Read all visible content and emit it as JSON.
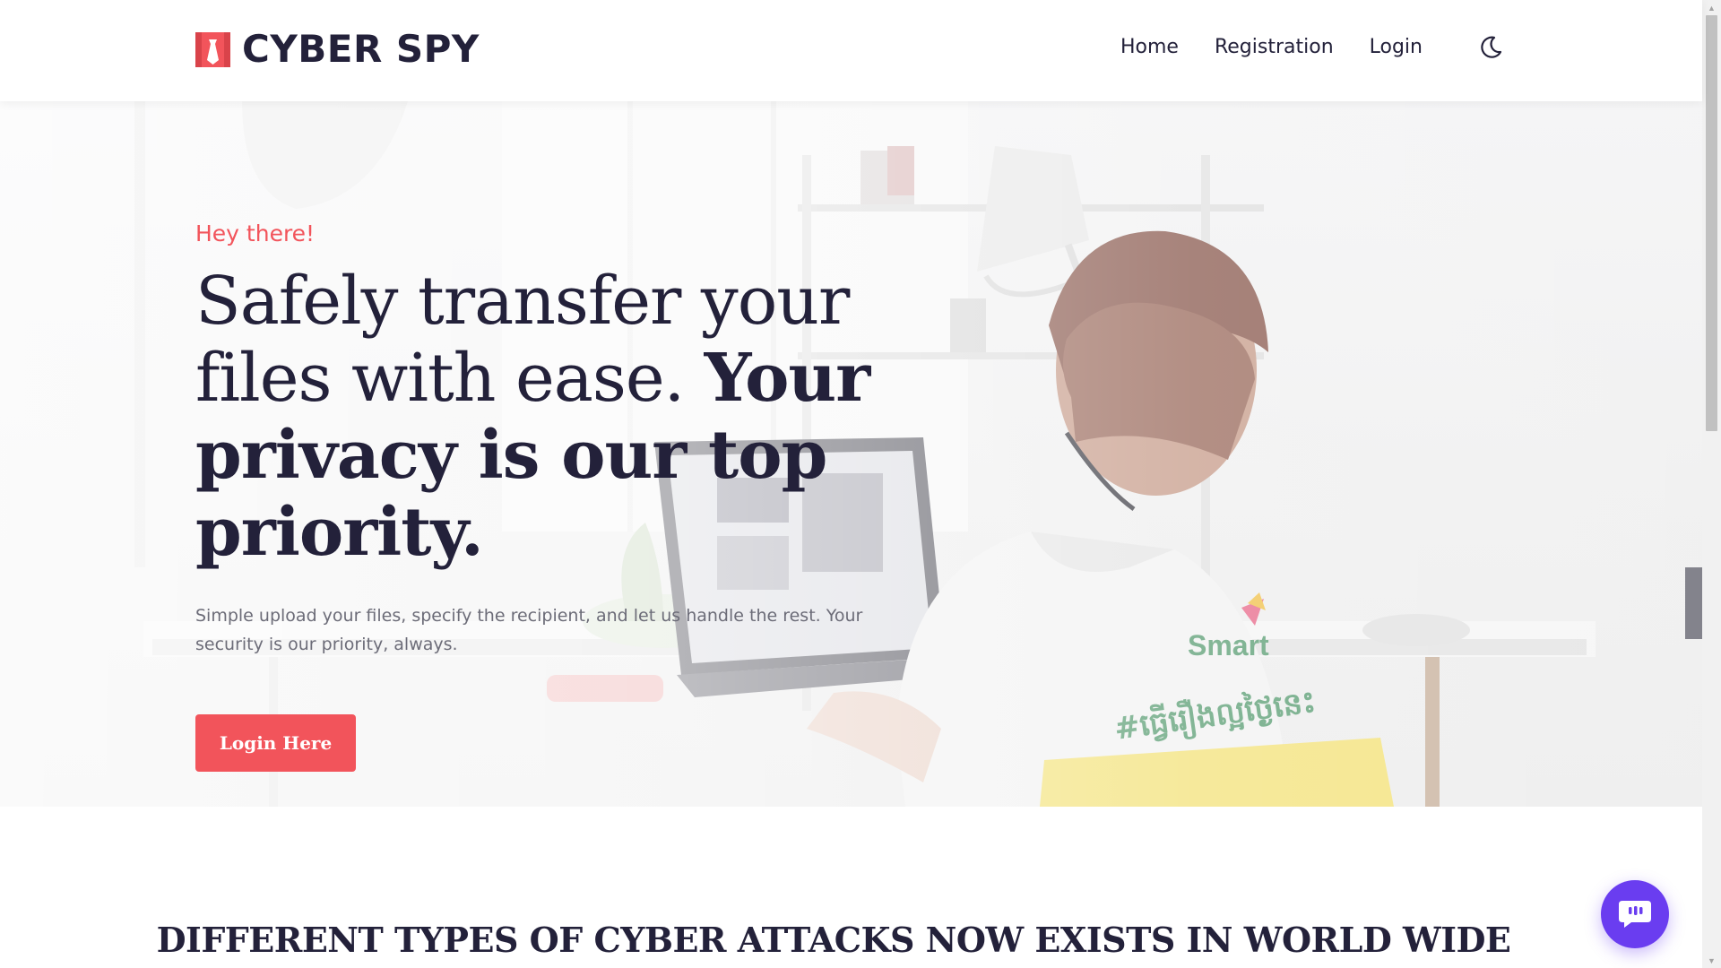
{
  "brand": {
    "name": "CYBER SPY",
    "icon": "tie-icon",
    "accent_color": "#f2545b"
  },
  "nav": {
    "items": [
      {
        "label": "Home"
      },
      {
        "label": "Registration"
      },
      {
        "label": "Login"
      }
    ],
    "theme_toggle_icon": "moon-icon"
  },
  "hero": {
    "kicker": "Hey there!",
    "title_regular": "Safely transfer your files with ease. ",
    "title_bold": "Your privacy is our top priority.",
    "description": "Simple upload your files, specify the recipient, and let us handle the rest. Your security is our priority, always.",
    "button_label": "Login Here",
    "background_image": {
      "shirt_brand": "Smart",
      "shirt_text": "#ធ្វើរឿងល្អថ្ងៃនេះ"
    }
  },
  "section": {
    "title": "DIFFERENT TYPES OF CYBER ATTACKS NOW EXISTS IN WORLD WIDE"
  },
  "chat_widget": {
    "icon": "chat-bubble-icon",
    "color": "#6a3df0"
  }
}
